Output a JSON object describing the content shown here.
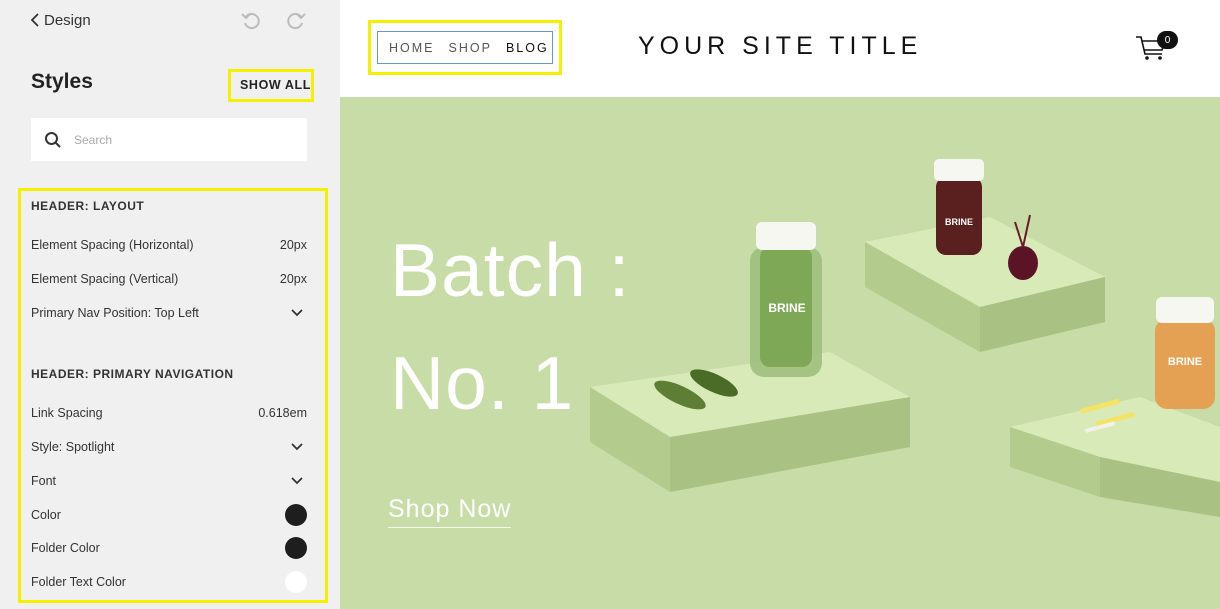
{
  "panel": {
    "back_label": "Design",
    "title": "Styles",
    "show_all_label": "SHOW ALL",
    "search_placeholder": "Search",
    "sections": [
      {
        "heading": "HEADER: LAYOUT",
        "rows": [
          {
            "label": "Element Spacing (Horizontal)",
            "value": "20px"
          },
          {
            "label": "Element Spacing (Vertical)",
            "value": "20px"
          },
          {
            "label": "Primary Nav Position: Top Left",
            "value": ""
          }
        ]
      },
      {
        "heading": "HEADER: PRIMARY NAVIGATION",
        "rows": [
          {
            "label": "Link Spacing",
            "value": "0.618em"
          },
          {
            "label": "Style: Spotlight",
            "value": ""
          },
          {
            "label": "Font",
            "value": ""
          },
          {
            "label": "Color",
            "value": "",
            "swatch": "#1e1e1e"
          },
          {
            "label": "Folder Color",
            "value": "",
            "swatch": "#1e1e1e"
          },
          {
            "label": "Folder Text Color",
            "value": "",
            "swatch": "#ffffff"
          }
        ]
      }
    ]
  },
  "site": {
    "nav": [
      "HOME",
      "SHOP",
      "BLOG"
    ],
    "active_nav": "BLOG",
    "title": "YOUR SITE TITLE",
    "cart_count": "0",
    "hero": {
      "line1": "Batch :",
      "line2": "No. 1",
      "cta": "Shop Now",
      "jar_label": "BRINE"
    }
  },
  "colors": {
    "highlight": "#f4f000",
    "hero_bg": "#c7dca6",
    "panel_bg": "#f0f0f0",
    "nav_border": "#6a97d3"
  }
}
